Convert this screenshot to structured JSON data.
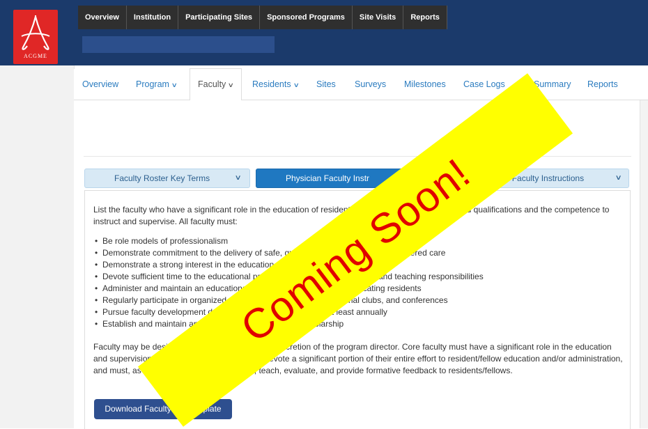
{
  "logo": {
    "text": "ACGME"
  },
  "topnav": [
    "Overview",
    "Institution",
    "Participating Sites",
    "Sponsored Programs",
    "Site Visits",
    "Reports"
  ],
  "subnav": {
    "overview": "Overview",
    "program": "Program",
    "faculty": "Faculty",
    "residents": "Residents",
    "sites": "Sites",
    "surveys": "Surveys",
    "milestones": "Milestones",
    "case_logs": "Case Logs",
    "summary": "Summary",
    "reports": "Reports",
    "active": "Faculty"
  },
  "tabs": {
    "roster_key_terms": "Faculty Roster Key Terms",
    "physician_instr": "Physician Faculty Instr",
    "nonphysician_instr": "Non-Physician Faculty Instructions"
  },
  "content": {
    "intro": "List the faculty who have a significant role in the education of residents and who have the documented qualifications and the competence to instruct and supervise. All faculty must:",
    "bullets": [
      "Be role models of professionalism",
      "Demonstrate commitment to the delivery of safe, quality, cost-effective, patient-centered care",
      "Demonstrate a strong interest in the education of residents",
      "Devote sufficient time to the educational program to fulfill their supervisory and teaching responsibilities",
      "Administer and maintain an educational environment conducive to educating residents",
      "Regularly participate in organized clinical discussions, rounds, journal clubs, and conferences",
      "Pursue faculty development designed to enhance their skills at least annually",
      "Establish and maintain an environment of inquiry and scholarship"
    ],
    "outro": "Faculty may be designated as core faculty at the discretion of the program director. Core faculty must have a significant role in the education and supervision of residents/fellows and must devote a significant portion of their entire effort to resident/fellow education and/or administration, and must, as a component of their activities, teach, evaluate, and provide formative feedback to residents/fellows.",
    "download_button": "Download Faculty CV Template"
  },
  "banner": {
    "text": "Coming Soon!"
  },
  "colors": {
    "header": "#1b3a6b",
    "logo_red": "#e02726",
    "link_blue": "#2a7bbf",
    "tab_active": "#1f78c1",
    "button": "#2e4f8f",
    "banner_yellow": "#ffff00",
    "banner_text": "#e00000"
  }
}
